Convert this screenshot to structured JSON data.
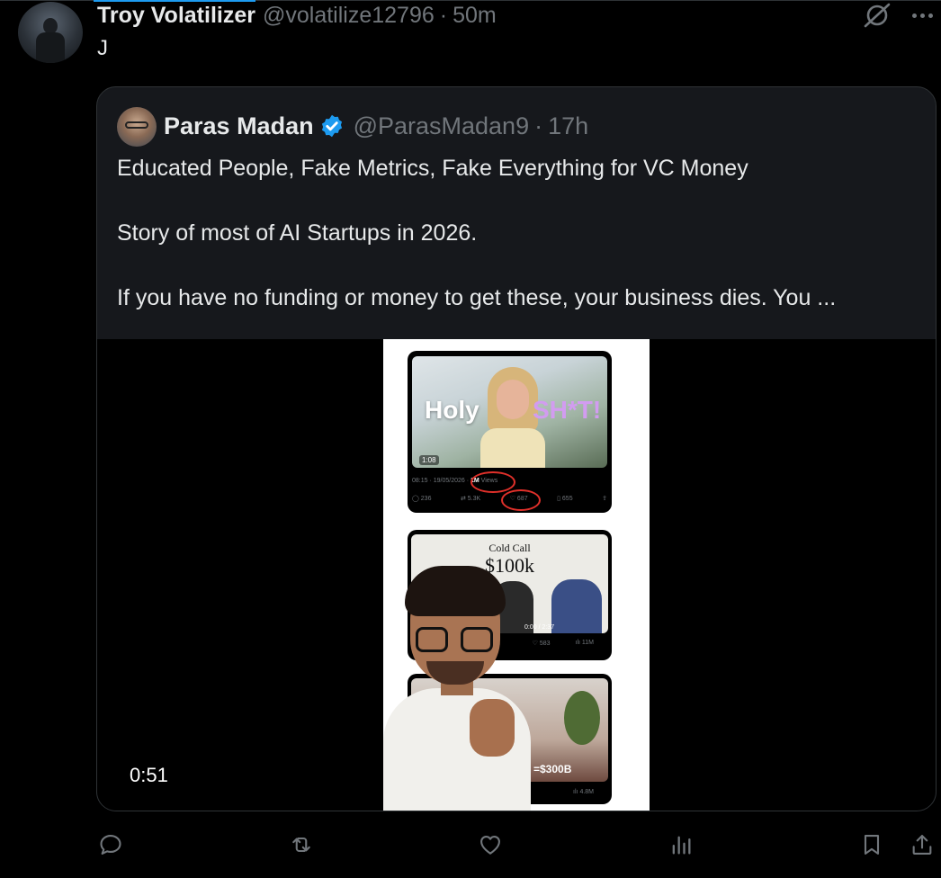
{
  "post": {
    "author_name": "Troy Volatilizer",
    "author_handle": "@volatilize12796",
    "separator": "·",
    "time": "50m",
    "text": "J"
  },
  "quoted_post": {
    "author_name": "Paras Madan",
    "author_handle": "@ParasMadan9",
    "separator": "·",
    "time": "17h",
    "verified": true,
    "lines": [
      "Educated People, Fake Metrics, Fake Everything for VC Money",
      "Story of most of AI Startups in 2026.",
      "If you have no funding or money to get these, your business dies. You ..."
    ],
    "video_duration": "0:51"
  },
  "video_content": {
    "card1": {
      "overlay_word1": "Holy",
      "overlay_word2": "SH*T!",
      "duration": "1:08",
      "meta_prefix": "08:15 · 19/05/2026 · ",
      "views_value": "1M",
      "views_label": " Views",
      "replies": "236",
      "reposts": "5.3K",
      "likes": "687",
      "bookmarks": "655"
    },
    "card2": {
      "title_small": "Cold Call",
      "title_big": "$100k",
      "time": "0:00 / 2:37",
      "likes": "583",
      "views": "11M"
    },
    "card3": {
      "label": "=$300B",
      "views": "4.8M"
    }
  },
  "actions": {
    "reply": "reply",
    "repost": "repost",
    "like": "like",
    "views": "views",
    "bookmark": "bookmark",
    "share": "share"
  },
  "colors": {
    "background": "#000000",
    "text": "#e7e9ea",
    "muted": "#71767b",
    "accent": "#1d9bf0",
    "border": "#2f3336"
  }
}
